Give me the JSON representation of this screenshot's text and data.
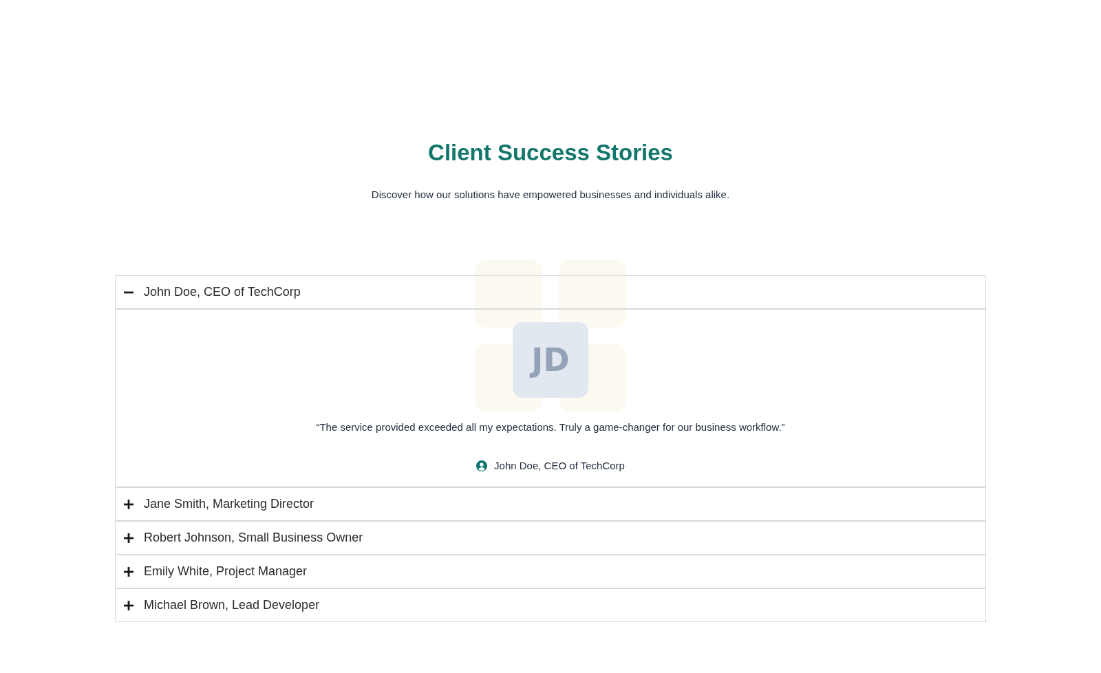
{
  "header": {
    "title": "Client Success Stories",
    "subtitle": "Discover how our solutions have empowered businesses and individuals alike."
  },
  "accordion": {
    "items": [
      {
        "name": "John Doe, CEO of TechCorp",
        "expanded": true,
        "avatar_initials": "JD",
        "quote": "“The service provided exceeded all my expectations. Truly a game-changer for our business workflow.”",
        "author": "John Doe, CEO of TechCorp"
      },
      {
        "name": "Jane Smith, Marketing Director",
        "expanded": false
      },
      {
        "name": "Robert Johnson, Small Business Owner",
        "expanded": false
      },
      {
        "name": "Emily White, Project Manager",
        "expanded": false
      },
      {
        "name": "Michael Brown, Lead Developer",
        "expanded": false
      }
    ]
  }
}
